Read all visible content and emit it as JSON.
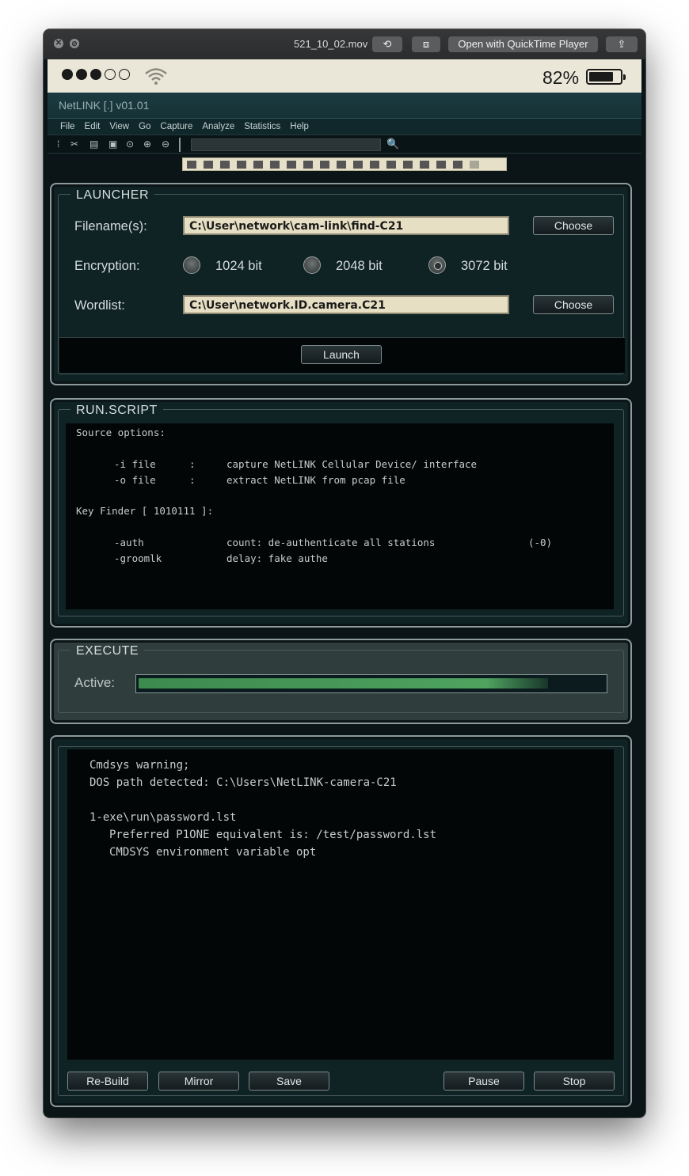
{
  "quicktime": {
    "filename": "521_10_02.mov",
    "open_label": "Open with QuickTime Player",
    "close_glyph": "✕",
    "min_glyph": "⊘",
    "rotate_glyph": "⟲",
    "trim_glyph": "⧈",
    "share_glyph": "⇪"
  },
  "status": {
    "signal_dots_filled": 3,
    "signal_dots_total": 5,
    "battery_pct": "82%",
    "battery_level": 0.82
  },
  "app": {
    "title": "NetLINK [.] v01.01",
    "menu": [
      "File",
      "Edit",
      "View",
      "Go",
      "Capture",
      "Analyze",
      "Statistics",
      "Help"
    ],
    "toolbar_icons": [
      "grip-icon",
      "tools-icon",
      "open-file-icon",
      "save-file-icon",
      "zoom-icon",
      "zoom-in-icon",
      "zoom-out-icon"
    ],
    "search_icon": "🔍"
  },
  "launcher": {
    "title": "LAUNCHER",
    "filename_label": "Filename(s):",
    "filename_value": "C:\\User\\network\\cam-link\\find-C21",
    "choose_label": "Choose",
    "encryption_label": "Encryption:",
    "encryption_options": [
      "1024 bit",
      "2048 bit",
      "3072 bit"
    ],
    "encryption_selected": "3072 bit",
    "wordlist_label": "Wordlist:",
    "wordlist_value": "C:\\User\\network.ID.camera.C21",
    "choose2_label": "Choose",
    "launch_label": "Launch"
  },
  "run_script": {
    "title": "RUN.SCRIPT",
    "source_header": "Source options:",
    "opt1": {
      "flag": "-i file",
      "sep": ":",
      "desc": "capture NetLINK Cellular Device/ interface"
    },
    "opt2": {
      "flag": "-o file",
      "sep": ":",
      "desc": "extract NetLINK from pcap file"
    },
    "key_header": "Key Finder [ 1010111 ]:",
    "key1": {
      "flag": "-auth",
      "desc": "count: de-authenticate all stations",
      "extra": "(-0)"
    },
    "key2": {
      "flag": "-groomlk",
      "desc": "delay: fake authe"
    }
  },
  "execute": {
    "title": "EXECUTE",
    "active_label": "Active:",
    "progress": 0.88
  },
  "output": {
    "line1": "Cmdsys warning;",
    "line2": "DOS path detected: C:\\Users\\NetLINK-camera-C21",
    "line3": "1-exe\\run\\password.lst",
    "line4": "Preferred P1ONE equivalent is: /test/password.lst",
    "line5": "CMDSYS environment variable opt",
    "buttons": {
      "rebuild": "Re-Build",
      "mirror": "Mirror",
      "save": "Save",
      "pause": "Pause",
      "stop": "Stop"
    }
  }
}
